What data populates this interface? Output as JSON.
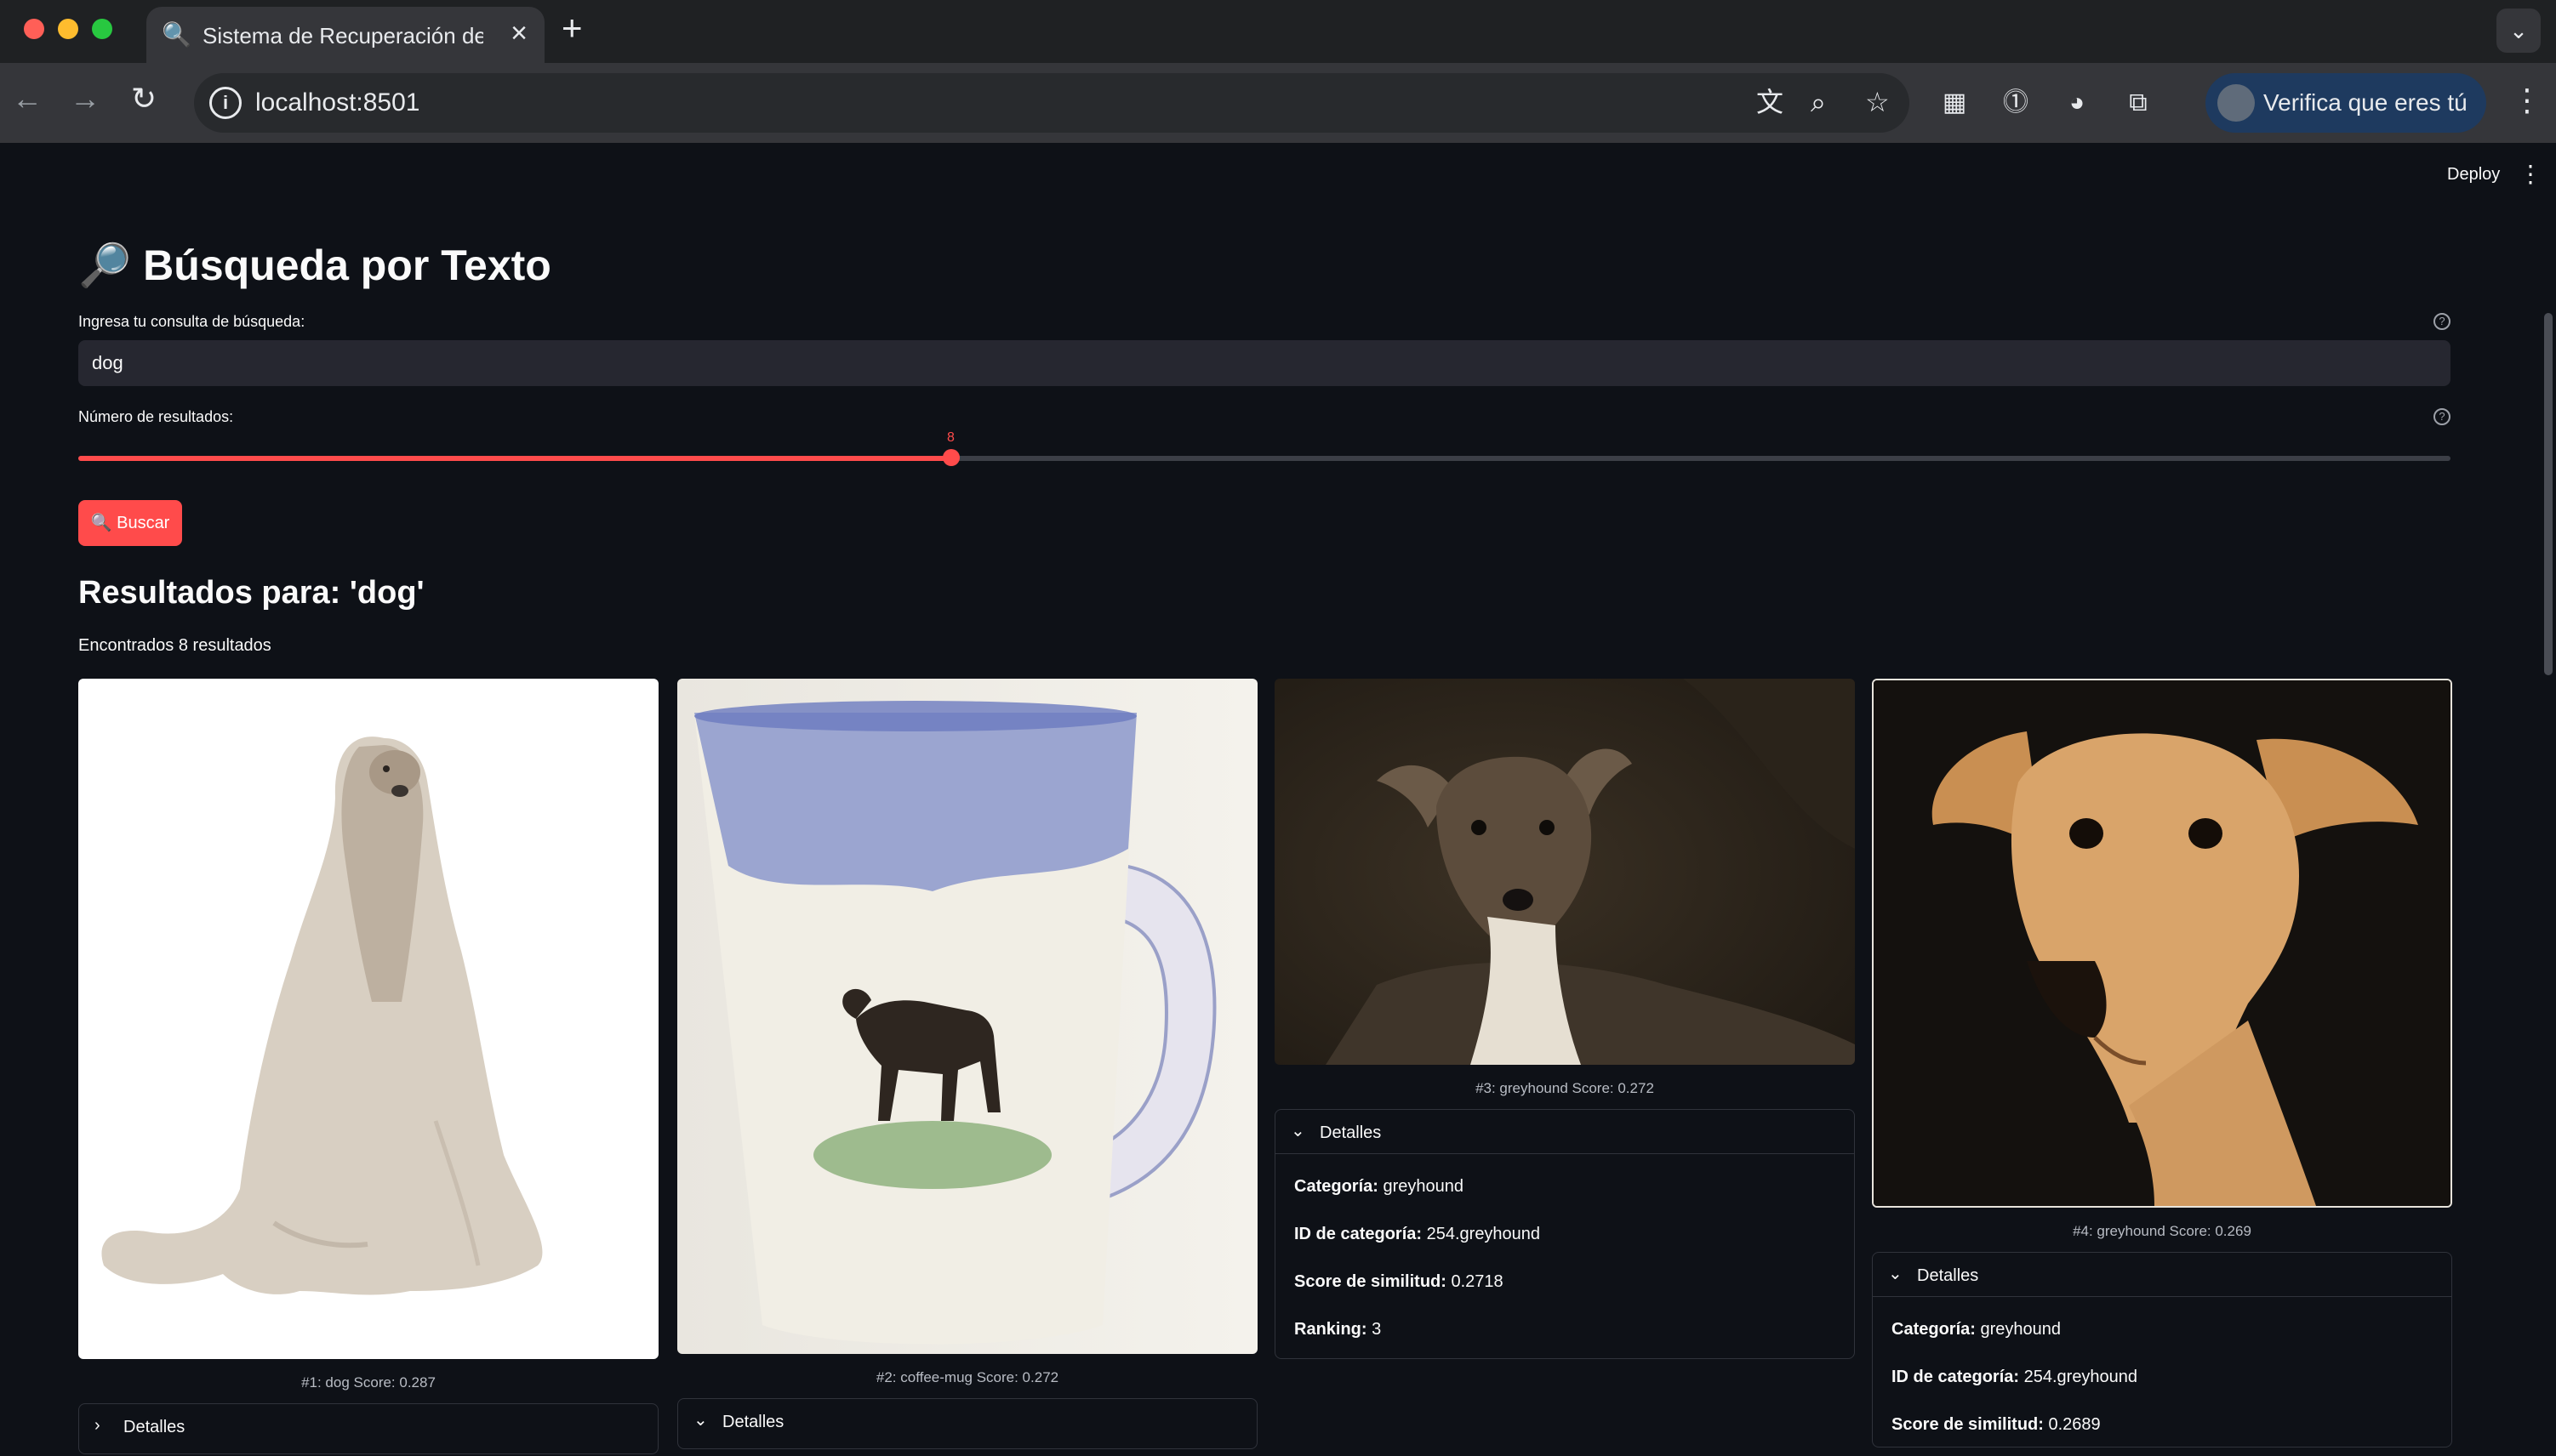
{
  "browser": {
    "tab_title": "Sistema de Recuperación de I",
    "url": "localhost:8501",
    "profile_label": "Verifica que eres tú"
  },
  "app": {
    "deploy_label": "Deploy",
    "title_icon": "🔎",
    "title": "Búsqueda por Texto",
    "query_label": "Ingresa tu consulta de búsqueda:",
    "query_value": "dog",
    "num_label": "Número de resultados:",
    "num_value": "8",
    "slider_fraction": 0.368,
    "search_button": "🔍 Buscar",
    "results_title": "Resultados para: 'dog'",
    "results_count": "Encontrados 8 resultados",
    "expander_label": "Detalles"
  },
  "results": [
    {
      "caption": "#1: dog Score: 0.287",
      "expanded": false
    },
    {
      "caption": "#2: coffee-mug Score: 0.272",
      "expanded": false
    },
    {
      "caption": "#3: greyhound Score: 0.272",
      "expanded": true,
      "details": [
        {
          "key": "Categoría:",
          "value": " greyhound"
        },
        {
          "key": "ID de categoría:",
          "value": " 254.greyhound"
        },
        {
          "key": "Score de similitud:",
          "value": " 0.2718"
        },
        {
          "key": "Ranking:",
          "value": " 3"
        }
      ]
    },
    {
      "caption": "#4: greyhound Score: 0.269",
      "expanded": true,
      "details": [
        {
          "key": "Categoría:",
          "value": " greyhound"
        },
        {
          "key": "ID de categoría:",
          "value": " 254.greyhound"
        },
        {
          "key": "Score de similitud:",
          "value": " 0.2689"
        }
      ]
    }
  ]
}
